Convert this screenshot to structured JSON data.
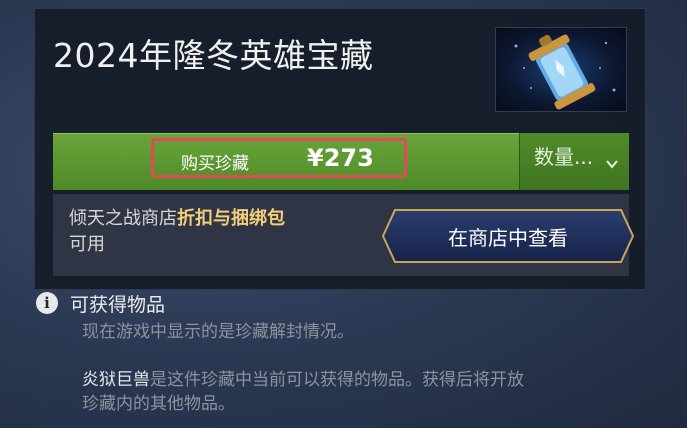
{
  "treasure": {
    "title": "2024年隆冬英雄宝藏",
    "thumbnail_icon": "treasure-vial-icon"
  },
  "purchase": {
    "buy_label": "购买珍藏",
    "price": "¥273",
    "quantity_label": "数量...",
    "quantity_icon": "chevron-down-icon"
  },
  "discount": {
    "text_before": "倾天之战商店",
    "highlight": "折扣与捆绑包",
    "text_after": "可用",
    "store_button": "在商店中查看"
  },
  "obtainable": {
    "icon": "info-icon",
    "title": "可获得物品",
    "note": "现在游戏中显示的是珍藏解封情况。",
    "hero_item": "炎狱巨兽",
    "desc_line1": "是这件珍藏中当前可以获得的物品。获得后将开放",
    "desc_line2": "珍藏内的其他物品。"
  },
  "colors": {
    "buy_green": "#5a9a30",
    "highlight_red": "#e24a55",
    "discount_gold": "#f2cf7a",
    "store_button_navy": "#1b2c55"
  }
}
